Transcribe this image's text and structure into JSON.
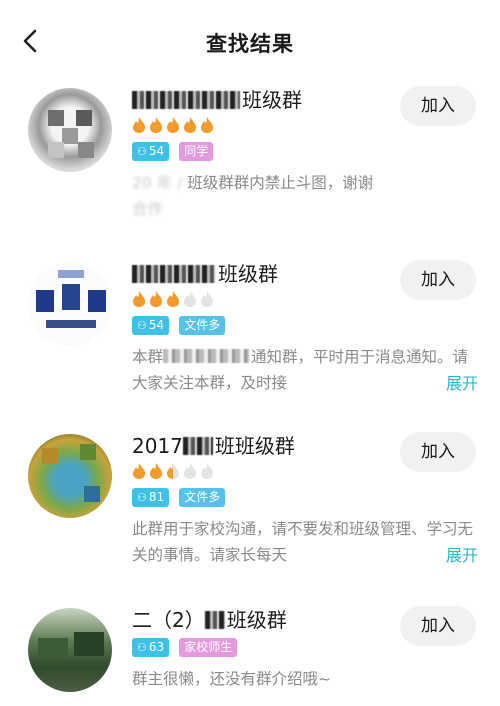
{
  "header": {
    "title": "查找结果"
  },
  "groups": [
    {
      "name": "班级群",
      "flames": [
        1,
        1,
        1,
        1,
        1
      ],
      "member_count": "54",
      "tag": "同学",
      "tag_color": "#e59ae0",
      "desc_blur": "20  年  /  ",
      "desc_text": "班级群群内禁止斗图，谢谢",
      "desc_line2": "合作",
      "join": "加入",
      "expand": ""
    },
    {
      "name": "班级群",
      "flames": [
        1,
        1,
        1,
        0,
        0
      ],
      "member_count": "54",
      "tag": "文件多",
      "tag_color": "#57c1ea",
      "desc_prefix": "本群",
      "desc_blur": "  ",
      "desc_text": "通知群，平时用于消息通知。请大家关注本群，及时接",
      "join": "加入",
      "expand": "展开"
    },
    {
      "name": "班班级群",
      "name_prefix": "2017",
      "flames": [
        1,
        1,
        0.5,
        0,
        0
      ],
      "member_count": "81",
      "tag": "文件多",
      "tag_color": "#57c1ea",
      "desc_text": "此群用于家校沟通，请不要发和班级管理、学习无关的事情。请家长每天",
      "join": "加入",
      "expand": "展开"
    },
    {
      "name": "班级群",
      "name_prefix": "二（2）",
      "flames": [],
      "member_count": "63",
      "tag": "家校师生",
      "tag_color": "#e59ae0",
      "desc_text": "群主很懒，还没有群介绍哦~",
      "join": "加入",
      "expand": ""
    }
  ],
  "colors": {
    "accent": "#2fb5c6",
    "flame_on": "#f39a2c",
    "flame_off": "#e4e4e4",
    "count_tag": "#3fc0e6"
  }
}
